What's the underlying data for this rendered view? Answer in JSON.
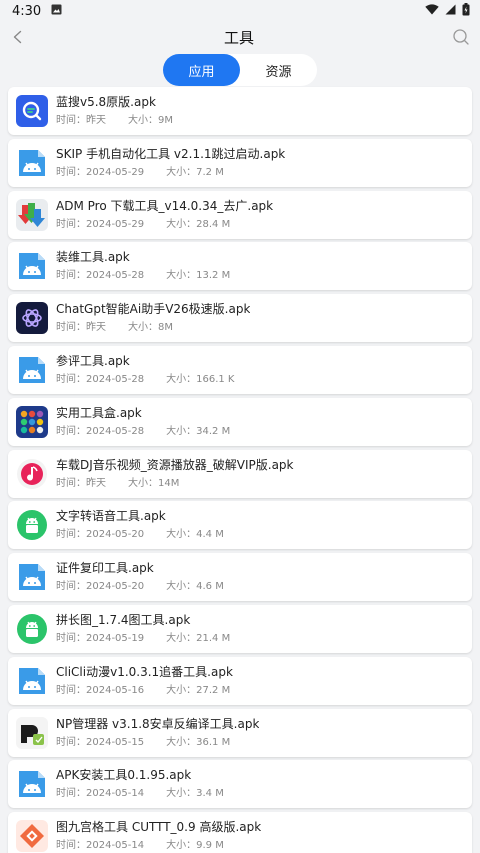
{
  "status": {
    "time": "4:30"
  },
  "header": {
    "title": "工具"
  },
  "tabs": [
    {
      "label": "应用",
      "active": true
    },
    {
      "label": "资源",
      "active": false
    }
  ],
  "colors": {
    "accent": "#1f77f2",
    "apk_blue": "#3a9be8",
    "android_green": "#2bc46a"
  },
  "items": [
    {
      "title": "蓝搜v5.8原版.apk",
      "time": "时间：昨天",
      "size": "大小：9M",
      "icon": "lansou-icon"
    },
    {
      "title": "SKIP 手机自动化工具 v2.1.1跳过启动.apk",
      "time": "时间：2024-05-29",
      "size": "大小：7.2 M",
      "icon": "apk-file-icon"
    },
    {
      "title": "ADM Pro 下载工具_v14.0.34_去广.apk",
      "time": "时间：2024-05-29",
      "size": "大小：28.4 M",
      "icon": "adm-icon"
    },
    {
      "title": "装维工具.apk",
      "time": "时间：2024-05-28",
      "size": "大小：13.2 M",
      "icon": "apk-file-icon"
    },
    {
      "title": "ChatGpt智能Ai助手V26极速版.apk",
      "time": "时间：昨天",
      "size": "大小：8M",
      "icon": "chatgpt-icon"
    },
    {
      "title": "参评工具.apk",
      "time": "时间：2024-05-28",
      "size": "大小：166.1 K",
      "icon": "apk-file-icon"
    },
    {
      "title": "实用工具盒.apk",
      "time": "时间：2024-05-28",
      "size": "大小：34.2 M",
      "icon": "toolbox-icon"
    },
    {
      "title": "车载DJ音乐视频_资源播放器_破解VIP版.apk",
      "time": "时间：昨天",
      "size": "大小：14M",
      "icon": "music-icon"
    },
    {
      "title": "文字转语音工具.apk",
      "time": "时间：2024-05-20",
      "size": "大小：4.4 M",
      "icon": "android-icon"
    },
    {
      "title": "证件复印工具.apk",
      "time": "时间：2024-05-20",
      "size": "大小：4.6 M",
      "icon": "apk-file-icon"
    },
    {
      "title": "拼长图_1.7.4图工具.apk",
      "time": "时间：2024-05-19",
      "size": "大小：21.4 M",
      "icon": "android-icon"
    },
    {
      "title": "CliCli动漫v1.0.3.1追番工具.apk",
      "time": "时间：2024-05-16",
      "size": "大小：27.2 M",
      "icon": "apk-file-icon"
    },
    {
      "title": "NP管理器 v3.1.8安卓反编译工具.apk",
      "time": "时间：2024-05-15",
      "size": "大小：36.1 M",
      "icon": "np-icon"
    },
    {
      "title": "APK安装工具0.1.95.apk",
      "time": "时间：2024-05-14",
      "size": "大小：3.4 M",
      "icon": "apk-file-icon"
    },
    {
      "title": "图九宫格工具 CUTTT_0.9 高级版.apk",
      "time": "时间：2024-05-14",
      "size": "大小：9.9 M",
      "icon": "grid-icon"
    }
  ]
}
